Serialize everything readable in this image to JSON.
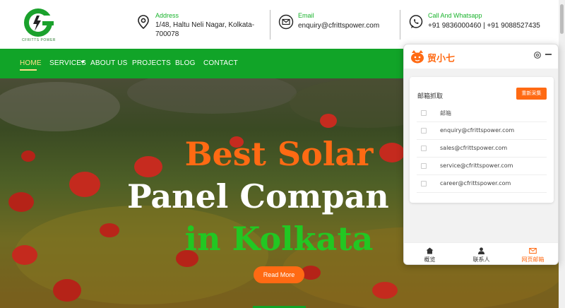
{
  "brand": {
    "logo_text": "CFRITTS POWER",
    "colors": {
      "green": "#11a428",
      "orange": "#ff6a13",
      "light_green": "#22c722"
    }
  },
  "header": {
    "address": {
      "title": "Address",
      "line1": "1/48, Haltu Neli Nagar, Kolkata-",
      "line2": "700078",
      "icon": "location-pin-icon"
    },
    "email": {
      "title": "Email",
      "value": "enquiry@cfrittspower.com",
      "icon": "envelope-icon"
    },
    "phone": {
      "title": "Call And Whatsapp",
      "value": "+91 9836000460 | +91 9088527435",
      "icon": "whatsapp-icon"
    }
  },
  "nav": {
    "items": [
      {
        "label": "HOME",
        "active": true
      },
      {
        "label": "SERVICES",
        "has_dropdown": true
      },
      {
        "label": "ABOUT US"
      },
      {
        "label": "PROJECTS"
      },
      {
        "label": "BLOG"
      },
      {
        "label": "CONTACT"
      }
    ]
  },
  "hero": {
    "line1": "Best Solar",
    "line2": "Panel Compan",
    "line3": "in Kolkata",
    "cta": "Read More"
  },
  "extension": {
    "title": "贸小七",
    "card_title": "邮箱抓取",
    "refresh_button": "重新采集",
    "column_header": "邮箱",
    "emails": [
      "enquiry@cfrittspower.com",
      "sales@cfrittspower.com",
      "service@cfrittspower.com",
      "career@cfrittspower.com"
    ],
    "footer": [
      {
        "label": "概览",
        "icon": "home-icon"
      },
      {
        "label": "联系人",
        "icon": "person-icon"
      },
      {
        "label": "网页邮箱",
        "icon": "mail-icon",
        "active": true
      }
    ]
  }
}
